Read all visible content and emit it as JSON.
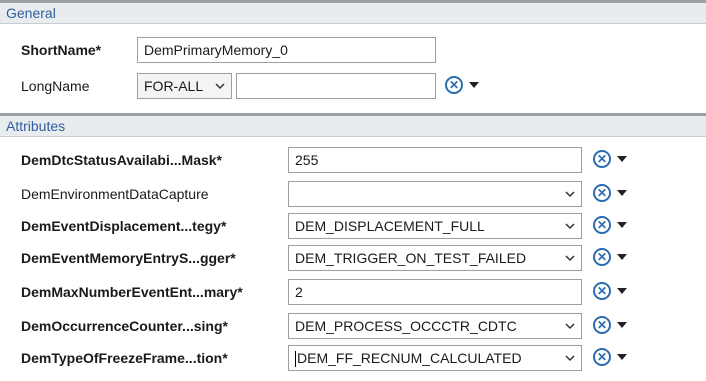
{
  "general": {
    "header": "General",
    "short_name_label": "ShortName*",
    "short_name_value": "DemPrimaryMemory_0",
    "long_name_label": "LongName",
    "long_name_lang": "FOR-ALL",
    "long_name_value": ""
  },
  "attributes": {
    "header": "Attributes",
    "rows": [
      {
        "label": "DemDtcStatusAvailabi...Mask*",
        "value": "255"
      },
      {
        "label": "DemEnvironmentDataCapture",
        "value": ""
      },
      {
        "label": "DemEventDisplacement...tegy*",
        "value": "DEM_DISPLACEMENT_FULL"
      },
      {
        "label": "DemEventMemoryEntryS...gger*",
        "value": "DEM_TRIGGER_ON_TEST_FAILED"
      },
      {
        "label": "DemMaxNumberEventEnt...mary*",
        "value": "2"
      },
      {
        "label": "DemOccurrenceCounter...sing*",
        "value": "DEM_PROCESS_OCCCTR_CDTC"
      },
      {
        "label": "DemTypeOfFreezeFrame...tion*",
        "value": "DEM_FF_RECNUM_CALCULATED"
      }
    ]
  },
  "icons": {
    "tool": "wrench-circle-icon",
    "dropdown": "triangle-down-icon",
    "combo_arrow": "chevron-down-icon"
  },
  "colors": {
    "section_header_text": "#2f5e9e",
    "section_header_bg": "#e9ecef",
    "icon_blue": "#2b6cb0"
  }
}
